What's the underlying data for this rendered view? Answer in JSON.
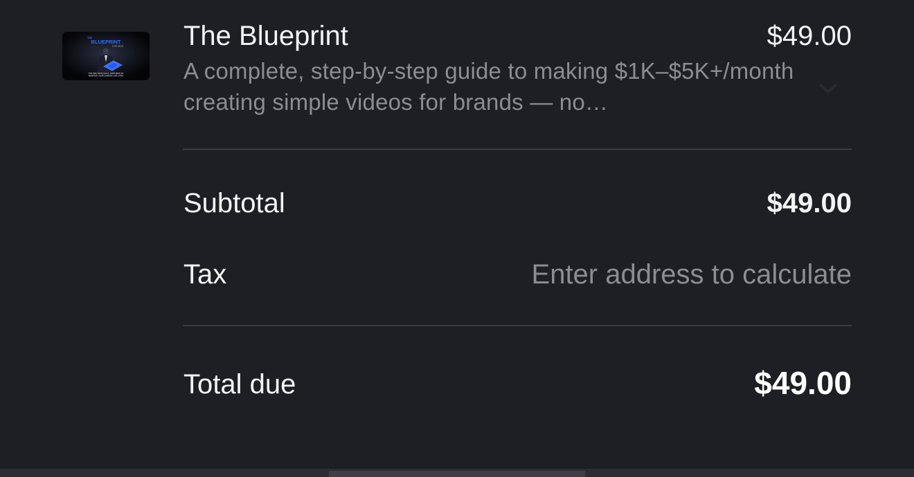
{
  "product": {
    "name": "The Blueprint",
    "price": "$49.00",
    "description": "A complete, step-by-step guide to making $1K–$5K+/month creating simple videos for brands — no…",
    "thumbnail": {
      "title_small": "THE",
      "title_main": "BLUEPRINT",
      "subtitle": "FOR MEN",
      "caption_line1": "THE ONLY NOW FOOLS, EVER NEED TO",
      "caption_line2": "MONETIZE YOUR CONTENT LIKE A PRO"
    },
    "expand_icon": "chevron-down-icon"
  },
  "summary": {
    "subtotal_label": "Subtotal",
    "subtotal_value": "$49.00",
    "tax_label": "Tax",
    "tax_value": "Enter address to calculate",
    "total_label": "Total due",
    "total_value": "$49.00"
  },
  "colors": {
    "background": "#1e1f24",
    "text_primary": "#f4f4f6",
    "text_muted": "#8c8d93",
    "divider": "#3a3b41",
    "accent_blue": "#2f6bff"
  }
}
